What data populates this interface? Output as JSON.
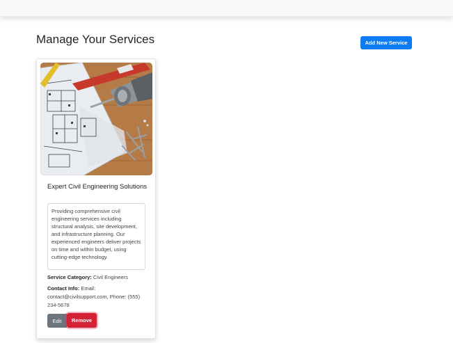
{
  "header": {
    "page_title": "Manage Your Services",
    "add_button_label": "Add New Service"
  },
  "services": [
    {
      "image_icon": "construction-blueprint-drill-photo",
      "title": "Expert Civil Engineering Solutions",
      "description": "Providing comprehensive civil engineering services including structural analysis, site development, and infrastructure planning. Our experienced engineers deliver projects on time and within budget, using cutting-edge technology.",
      "category_label": "Service Category:",
      "category_value": "Civil Engineers",
      "contact_label": "Contact Info:",
      "contact_value": "Email: contact@civilsupport.com, Phone: (555) 234-5678",
      "edit_label": "Edit",
      "remove_label": "Remove"
    }
  ],
  "colors": {
    "primary": "#0d7cf2",
    "secondary": "#6c757d",
    "danger": "#d32236",
    "navbar_bg": "#f8f9fa"
  }
}
